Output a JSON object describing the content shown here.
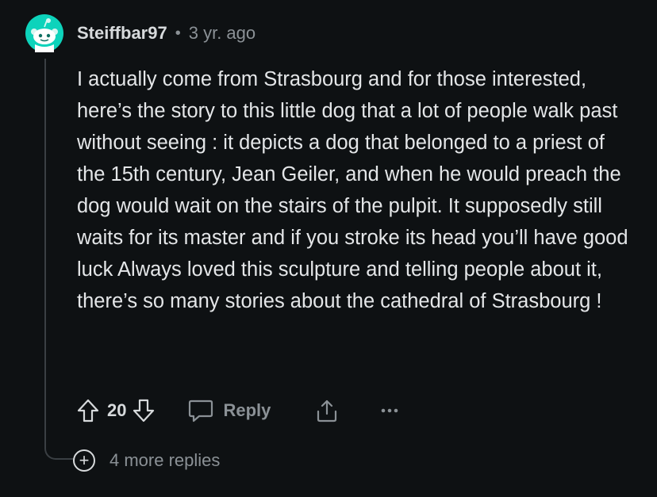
{
  "comment": {
    "username": "Steiffbar97",
    "separator": "•",
    "timestamp": "3 yr. ago",
    "avatar_color": "#0dd3bb",
    "body": "I actually come from Strasbourg and for those interested, here’s the story to this little dog that a lot of people walk past without seeing : it depicts a dog that belonged to a priest of the 15th century, Jean Geiler, and when he would preach the dog would wait on the stairs of the pulpit. It supposedly still waits for its master and if you stroke its head you’ll have good luck Always loved this sculpture and telling people about it, there’s so many stories about the cathedral of Strasbourg !"
  },
  "actions": {
    "upvote_icon": "upvote-arrow-icon",
    "vote_count": "20",
    "downvote_icon": "downvote-arrow-icon",
    "reply_icon": "speech-bubble-icon",
    "reply_label": "Reply",
    "share_icon": "share-icon",
    "more_icon": "ellipsis-icon"
  },
  "thread": {
    "more_replies_icon": "plus-circle-icon",
    "more_replies_symbol": "+",
    "more_replies_label": "4 more replies"
  }
}
